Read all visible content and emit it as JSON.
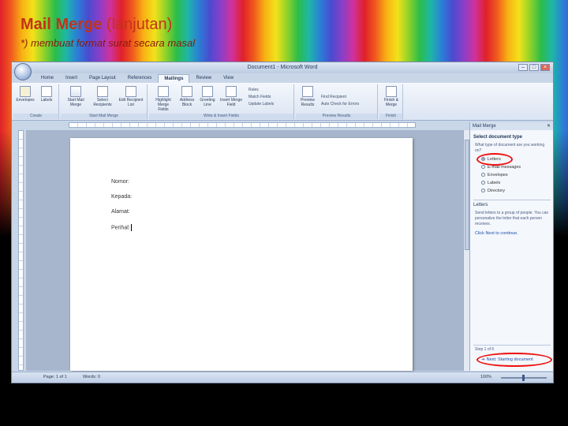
{
  "slide": {
    "title_bold": "Mail Merge",
    "title_light": "(lanjutan)",
    "subtitle": "*) membuat format surat secara masal"
  },
  "window": {
    "title": "Document1 - Microsoft Word",
    "controls": [
      "–",
      "□",
      "×"
    ]
  },
  "ribbon": {
    "tabs": [
      "Home",
      "Insert",
      "Page Layout",
      "References",
      "Mailings",
      "Review",
      "View"
    ],
    "active_tab": "Mailings",
    "groups": {
      "create": {
        "label": "Create",
        "buttons": [
          "Envelopes",
          "Labels"
        ]
      },
      "start_mail_merge": {
        "label": "Start Mail Merge",
        "buttons": [
          "Start Mail Merge",
          "Select Recipients",
          "Edit Recipient List"
        ]
      },
      "write_insert_fields": {
        "label": "Write & Insert Fields",
        "buttons": [
          "Highlight Merge Fields",
          "Address Block",
          "Greeting Line",
          "Insert Merge Field"
        ],
        "small": [
          "Rules",
          "Match Fields",
          "Update Labels"
        ]
      },
      "preview_results": {
        "label": "Preview Results",
        "buttons": [
          "Preview Results"
        ],
        "small": [
          "Find Recipient",
          "Auto Check for Errors"
        ]
      },
      "finish": {
        "label": "Finish",
        "buttons": [
          "Finish & Merge"
        ]
      }
    }
  },
  "document": {
    "fields": [
      "Nomor:",
      "Kepada:",
      "Alamat:",
      "Perihal:"
    ]
  },
  "task_pane": {
    "title": "Mail Merge",
    "section_type": "Select document type",
    "question": "What type of document are you working on?",
    "options": [
      "Letters",
      "E-mail messages",
      "Envelopes",
      "Labels",
      "Directory"
    ],
    "selected_option": "Letters",
    "section_letters": "Letters",
    "description": "Send letters to a group of people. You can personalize the letter that each person receives.",
    "continue_link": "Click Next to continue.",
    "step_label": "Step 1 of 6",
    "next_link": "Next: Starting document"
  },
  "statusbar": {
    "page": "Page: 1 of 1",
    "words": "Words: 0",
    "zoom": "100%"
  },
  "colors": {
    "title": "#c23318",
    "highlight_ellipse": "#ee1111",
    "word_chrome": "#c9d6e8"
  },
  "icons": [
    "office-button-icon",
    "envelope-icon",
    "document-icon",
    "radio-icon",
    "arrow-right-icon"
  ]
}
